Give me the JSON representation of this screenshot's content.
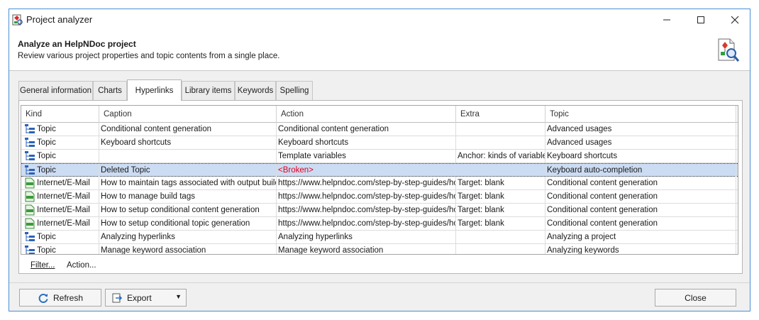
{
  "window": {
    "title": "Project analyzer",
    "colors": {
      "border": "#4a8fd6",
      "selection": "#ccdcf3",
      "broken": "#e0001a"
    }
  },
  "header": {
    "title": "Analyze an HelpNDoc project",
    "subtitle": "Review various project properties and topic contents from a single place.",
    "icon": "analyze-document-magnifier-icon"
  },
  "tabs": [
    {
      "label": "General information"
    },
    {
      "label": "Charts"
    },
    {
      "label": "Hyperlinks",
      "active": true
    },
    {
      "label": "Library items"
    },
    {
      "label": "Keywords"
    },
    {
      "label": "Spelling"
    }
  ],
  "grid": {
    "columns": [
      "Kind",
      "Caption",
      "Action",
      "Extra",
      "Topic"
    ],
    "rows": [
      {
        "kind": "Topic",
        "icon": "topic-tree-icon",
        "caption": "Conditional content generation",
        "action": "Conditional content generation",
        "extra": "",
        "topic": "Advanced usages"
      },
      {
        "kind": "Topic",
        "icon": "topic-tree-icon",
        "caption": "Keyboard shortcuts",
        "action": "Keyboard shortcuts",
        "extra": "",
        "topic": "Advanced usages"
      },
      {
        "kind": "Topic",
        "icon": "topic-tree-icon",
        "caption": "",
        "action": "Template variables",
        "extra": "Anchor: kinds of variables",
        "topic": "Keyboard shortcuts"
      },
      {
        "kind": "Topic",
        "icon": "topic-tree-icon",
        "caption": "Deleted Topic",
        "action": "<Broken>",
        "extra": "",
        "topic": "Keyboard auto-completion",
        "selected": true,
        "broken": true
      },
      {
        "kind": "Internet/E-Mail",
        "icon": "html-document-icon",
        "caption": "How to maintain tags associated with output builds",
        "action": "https://www.helpndoc.com/step-by-step-guides/ho",
        "extra": "Target: blank",
        "topic": "Conditional content generation"
      },
      {
        "kind": "Internet/E-Mail",
        "icon": "html-document-icon",
        "caption": "How to manage build tags",
        "action": "https://www.helpndoc.com/step-by-step-guides/ho",
        "extra": "Target: blank",
        "topic": "Conditional content generation"
      },
      {
        "kind": "Internet/E-Mail",
        "icon": "html-document-icon",
        "caption": "How to setup conditional content generation",
        "action": "https://www.helpndoc.com/step-by-step-guides/ho",
        "extra": "Target: blank",
        "topic": "Conditional content generation"
      },
      {
        "kind": "Internet/E-Mail",
        "icon": "html-document-icon",
        "caption": "How to setup conditional topic generation",
        "action": "https://www.helpndoc.com/step-by-step-guides/ho",
        "extra": "Target: blank",
        "topic": "Conditional content generation"
      },
      {
        "kind": "Topic",
        "icon": "topic-tree-icon",
        "caption": "Analyzing hyperlinks",
        "action": "Analyzing hyperlinks",
        "extra": "",
        "topic": "Analyzing a project"
      },
      {
        "kind": "Topic",
        "icon": "topic-tree-icon",
        "caption": "Manage keyword association",
        "action": "Manage keyword association",
        "extra": "",
        "topic": "Analyzing keywords"
      }
    ]
  },
  "links": {
    "filter": "Filter...",
    "action": "Action..."
  },
  "buttons": {
    "refresh": "Refresh",
    "export": "Export",
    "close": "Close"
  }
}
